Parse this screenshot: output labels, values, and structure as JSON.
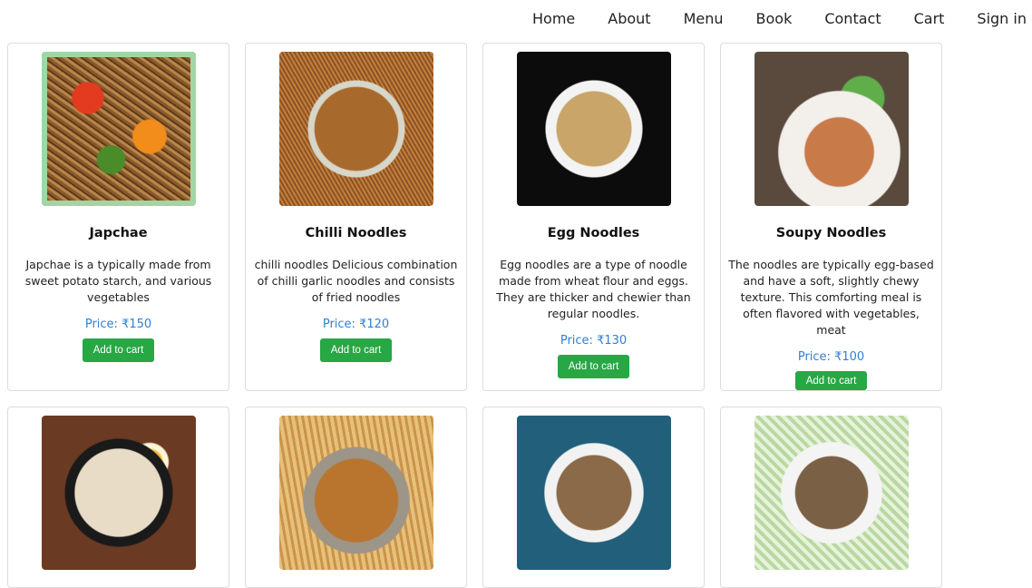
{
  "nav": {
    "items": [
      "Home",
      "About",
      "Menu",
      "Book",
      "Contact",
      "Cart",
      "Sign in"
    ]
  },
  "products": [
    {
      "title": "Japchae",
      "description": "Japchae is a typically made from sweet potato starch, and various vegetables",
      "price": "Price: ₹150",
      "button": "Add to cart"
    },
    {
      "title": "Chilli Noodles",
      "description": "chilli noodles Delicious combination of chilli garlic noodles and consists of fried noodles",
      "price": "Price: ₹120",
      "button": "Add to cart"
    },
    {
      "title": "Egg Noodles",
      "description": "Egg noodles are a type of noodle made from wheat flour and eggs. They are thicker and chewier than regular noodles.",
      "price": "Price: ₹130",
      "button": "Add to cart"
    },
    {
      "title": "Soupy Noodles",
      "description": "The noodles are typically egg-based and have a soft, slightly chewy texture. This comforting meal is often flavored with vegetables, meat",
      "price": "Price: ₹100",
      "button": "Add to cart"
    }
  ],
  "colors": {
    "button_bg": "#28a745",
    "price_text": "#2f7fd6"
  }
}
